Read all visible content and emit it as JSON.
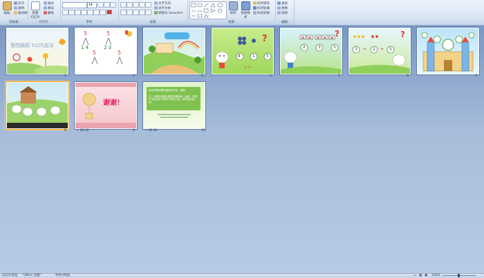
{
  "ribbon": {
    "groups": [
      {
        "name": "clipboard",
        "label": "剪贴板"
      },
      {
        "name": "slides",
        "label": "幻灯片"
      },
      {
        "name": "font",
        "label": "字体"
      },
      {
        "name": "paragraph",
        "label": "段落"
      },
      {
        "name": "drawing",
        "label": "绘图"
      },
      {
        "name": "editing",
        "label": "编辑"
      }
    ],
    "clipboard": {
      "paste": "粘贴",
      "cut": "剪切",
      "copy": "复制",
      "format_painter": "格式刷"
    },
    "slides": {
      "new_slide": "新建\n幻灯片",
      "layout": "版式",
      "reset": "重设",
      "delete": "删除"
    },
    "font": {
      "size": "18"
    },
    "paragraph": {
      "text_direction": "文字方向",
      "align_text": "对齐文本",
      "smartart": "转换为 SmartArt"
    },
    "drawing": {
      "arrange": "排列",
      "quick_styles": "快速样式",
      "shape_fill": "形状填充",
      "shape_outline": "形状轮廓",
      "shape_effects": "形状效果"
    },
    "editing": {
      "find": "查找",
      "replace": "替换",
      "select": "选择"
    }
  },
  "slides": [
    {
      "num": "1",
      "title": "看图编题 5以内加法"
    },
    {
      "num": "2",
      "top": "5",
      "bottom_left": "1 4",
      "bottom_right": "2 3"
    },
    {
      "num": "3"
    },
    {
      "num": "4",
      "n1": "4",
      "n2": "1",
      "n3": "5",
      "op": "+ ="
    },
    {
      "num": "5",
      "n1": "2",
      "n2": "3",
      "n3": "5"
    },
    {
      "num": "6",
      "n1": "3",
      "n2": "2",
      "n3": "5",
      "plus": "+",
      "eq": "="
    },
    {
      "num": "7"
    },
    {
      "num": "8"
    },
    {
      "num": "9",
      "thanks": "谢谢！"
    },
    {
      "num": "10",
      "text1": "欢迎你教师课件使用本文件，谢谢！",
      "text2": "注：该课件的图片素材来源网络，版权，仅限于本站会员下载学习研究之用，请勿商业使用。"
    }
  ],
  "status": {
    "slide_view": "幻灯片浏览",
    "theme": "\"Office 主题\"",
    "language": "中文(中国)",
    "zoom": "100%"
  },
  "colors": {
    "selected_border": "#e7a331",
    "ribbon_bg": "#d9e4f2"
  }
}
